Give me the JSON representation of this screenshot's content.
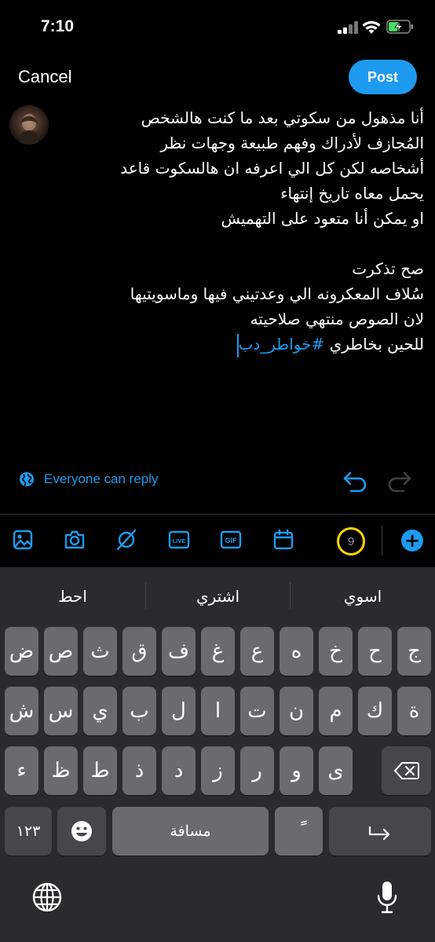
{
  "status_bar": {
    "time": "7:10"
  },
  "header": {
    "cancel_label": "Cancel",
    "post_label": "Post"
  },
  "tweet": {
    "lines": [
      "أنا مذهول من سكوتي بعد ما كنت هالشخص",
      "المُجازف لأدراك وفهم طبيعة وجهات نظر",
      "أشخاصه لكن كل الي اعرفه ان هالسكوت قاعد",
      "يحمل معاه تاريخ إنتهاء",
      "او يمكن أنا متعود على التهميش",
      "",
      "صح تذكرت",
      "سُلاف المعكرونه الي وعدتيني فيها وماسويتيها",
      "لان الصوص منتهي صلاحيته"
    ],
    "last_line_prefix": "للحين بخاطري ",
    "hashtag": "#خواطر_دب"
  },
  "reply_setting": {
    "label": "Everyone can reply"
  },
  "toolbar": {
    "icons": [
      "image-icon",
      "camera-icon",
      "gif-search-icon",
      "live-icon",
      "gif-icon",
      "schedule-icon"
    ],
    "char_counter": "9",
    "accent_color": "#1d9bf0",
    "counter_color": "#ffd400"
  },
  "keyboard": {
    "suggestions": [
      "اسوي",
      "اشتري",
      "احط"
    ],
    "row1": [
      "ج",
      "ح",
      "خ",
      "ه",
      "ع",
      "غ",
      "ف",
      "ق",
      "ث",
      "ص",
      "ض"
    ],
    "row2": [
      "ة",
      "ك",
      "م",
      "ن",
      "ت",
      "ا",
      "ل",
      "ب",
      "ي",
      "س",
      "ش"
    ],
    "row3": [
      "ى",
      "و",
      "ر",
      "ز",
      "د",
      "ذ",
      "ط",
      "ظ",
      "ء"
    ],
    "numbers_label": "١٢٣",
    "space_label": "مسافة",
    "diacritic_label": "ً"
  }
}
